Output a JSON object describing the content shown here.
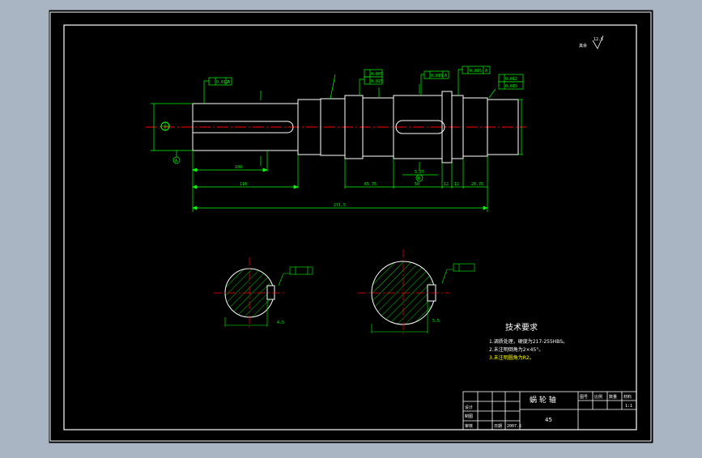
{
  "colors": {
    "app_bg": "#a9b5c3",
    "paper": "#000000",
    "frame": "#ffffff",
    "geometry": "#ffffff",
    "dimension": "#00ff00",
    "centerline": "#ff0000",
    "hatch": "#00ff00",
    "note_text": "#ffffff",
    "highlight_text": "#ffff00"
  },
  "roughness_mark": {
    "prefix": "其余",
    "value": "12.5"
  },
  "dimensions": {
    "d100": "100",
    "d110": "110",
    "d65_75": "65.75",
    "d50": "50",
    "d12a": "12",
    "d12b": "12",
    "d28_75": "28.75",
    "d271_5": "271.5",
    "d5_25": "5.25",
    "d5": "5"
  },
  "tolerance_frames": [
    {
      "sym": "//",
      "val": "0.012",
      "ref": "A"
    },
    {
      "sym": "//",
      "val": "0.005",
      "ref": ""
    },
    {
      "sym": "//",
      "val": "0.025",
      "ref": "A"
    },
    {
      "sym": "//",
      "val": "0.015",
      "ref": "A"
    },
    {
      "sym": "//",
      "val": "0.015",
      "ref": "A"
    },
    {
      "sym": "//",
      "val": "0.012",
      "ref": "B"
    },
    {
      "sym": "//",
      "val": "0.015",
      "ref": ""
    }
  ],
  "datum_labels": [
    "A",
    "B"
  ],
  "section_views": [
    {
      "label": "A-A",
      "key_depth": "4.5"
    },
    {
      "label": "B-B",
      "key_depth": "5.5"
    }
  ],
  "tech_requirements": {
    "title": "技术要求",
    "items": [
      "1.调质处理，硬度为217-255HBS。",
      "2.未注明倒角为2×45°。",
      "3.未注明圆角为R2。"
    ]
  },
  "title_block": {
    "part_name": "蜗 轮 轴",
    "material": "45",
    "headers": [
      "图号",
      "比例",
      "数量",
      "材料"
    ],
    "scale": "1:1",
    "rows": [
      "设计",
      "制图",
      "审核"
    ],
    "date": "日期",
    "code": "2007.6"
  }
}
